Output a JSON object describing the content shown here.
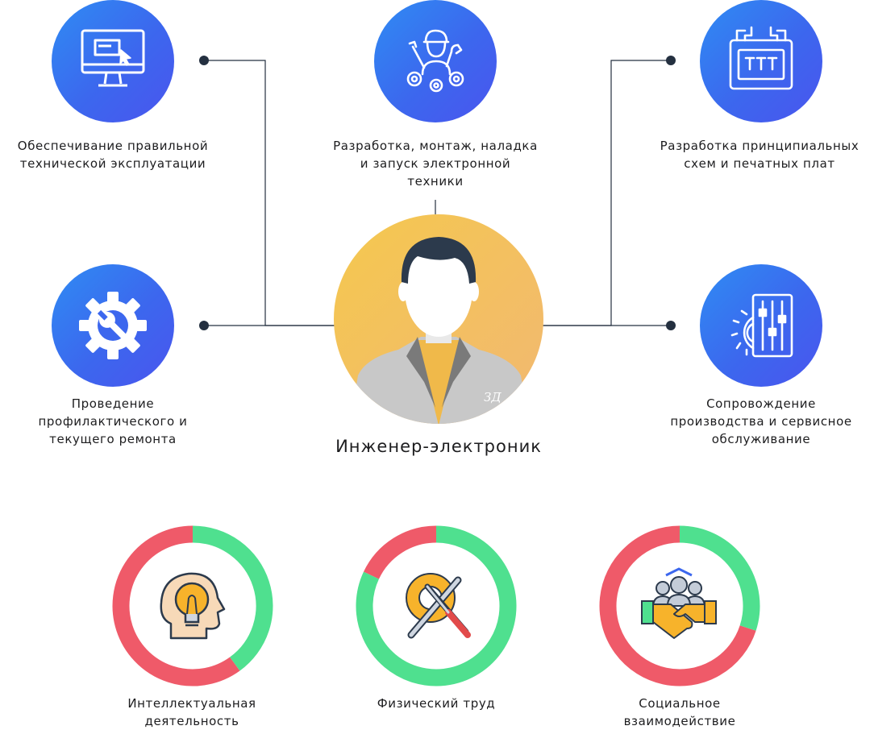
{
  "center": {
    "title": "Инженер-электроник"
  },
  "functions": [
    {
      "id": "exploitation",
      "label_lines": [
        "Обеспечивание правильной",
        "технической эксплуатации"
      ]
    },
    {
      "id": "development",
      "label_lines": [
        "Разработка, монтаж, наладка",
        "и запуск электронной",
        "техники"
      ]
    },
    {
      "id": "schemes",
      "label_lines": [
        "Разработка принципиальных",
        "схем и печатных плат"
      ]
    },
    {
      "id": "repair",
      "label_lines": [
        "Проведение",
        "профилактического и",
        "текущего ремонта"
      ]
    },
    {
      "id": "support",
      "label_lines": [
        "Сопровождение",
        "производства и сервисное",
        "обслуживание"
      ]
    }
  ],
  "activity_rings": [
    {
      "id": "intellectual",
      "label_lines": [
        "Интеллектуальная",
        "деятельность"
      ],
      "green_share": 0.4
    },
    {
      "id": "physical",
      "label_lines": [
        "Физический труд"
      ],
      "green_share": 0.82
    },
    {
      "id": "social",
      "label_lines": [
        "Социальное",
        "взаимодействие"
      ],
      "green_share": 0.3
    }
  ],
  "colors": {
    "icon_circle": "#3c67ee",
    "ring_green": "#4fe08f",
    "ring_red": "#ef5a69",
    "connector": "#243040",
    "avatar_bg": "#f3c25a"
  }
}
